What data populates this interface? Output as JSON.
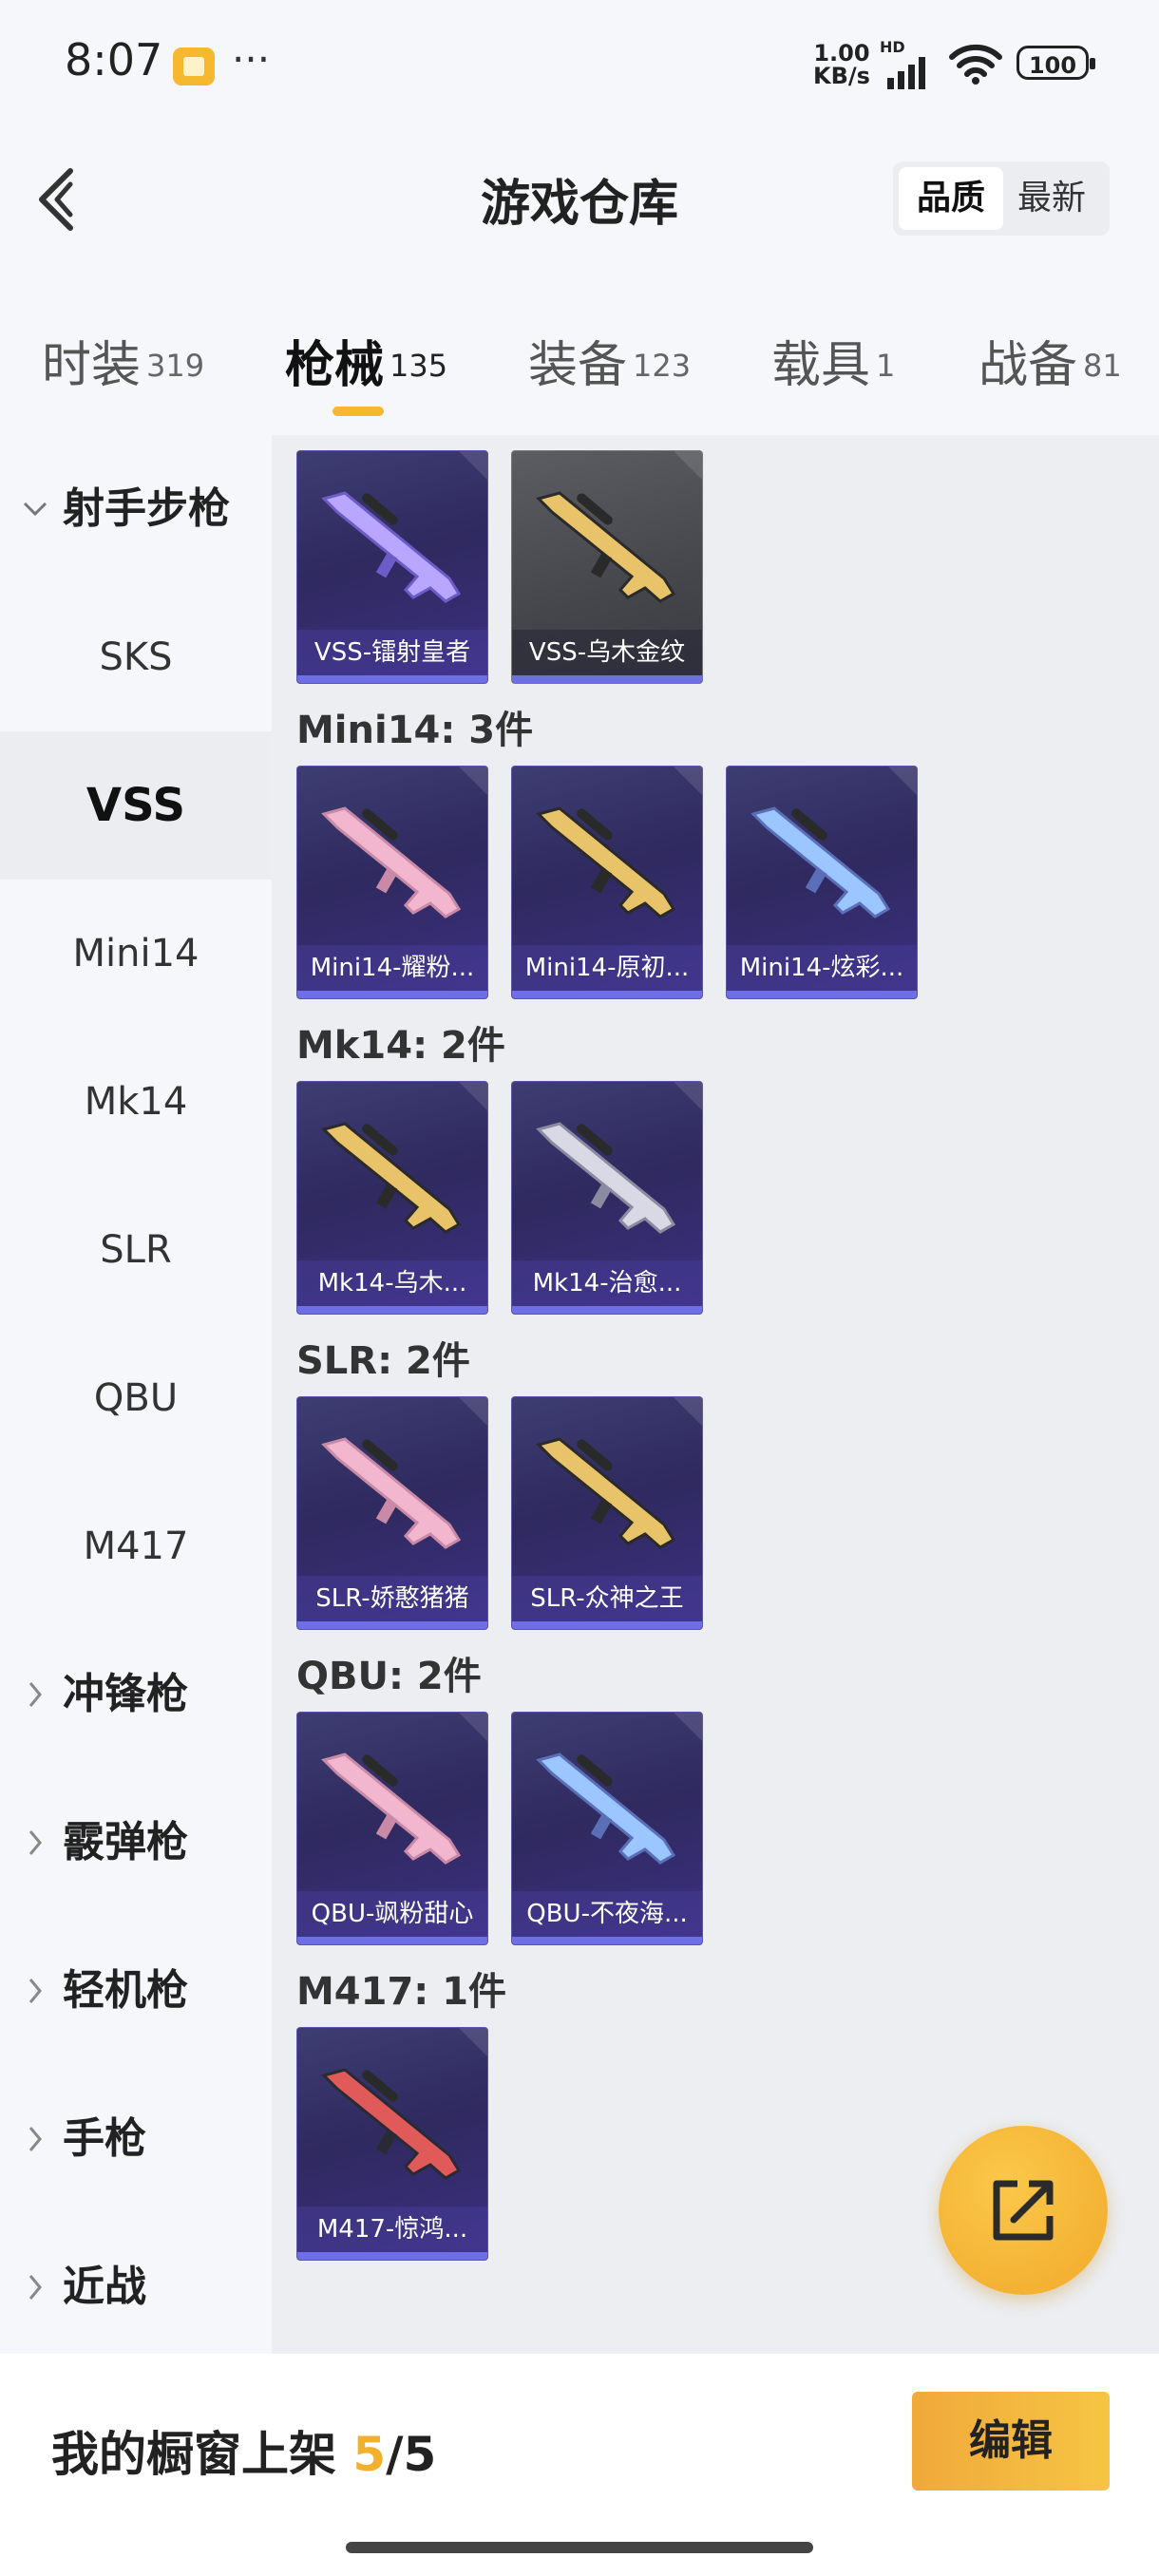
{
  "status_bar": {
    "time": "8:07",
    "dots": "···",
    "net_speed_value": "1.00",
    "net_speed_unit": "KB/s",
    "hd_label": "HD",
    "battery": "100"
  },
  "header": {
    "title": "游戏仓库",
    "sort_options": [
      "品质",
      "最新"
    ],
    "sort_selected": "品质"
  },
  "tabs": [
    {
      "label": "时装",
      "count": "319"
    },
    {
      "label": "枪械",
      "count": "135"
    },
    {
      "label": "装备",
      "count": "123"
    },
    {
      "label": "载具",
      "count": "1"
    },
    {
      "label": "战备",
      "count": "81"
    }
  ],
  "tabs_active": "枪械",
  "sidebar": {
    "expanded_group": "射手步枪",
    "sub_items": [
      "SKS",
      "VSS",
      "Mini14",
      "Mk14",
      "SLR",
      "QBU",
      "M417"
    ],
    "selected_item": "VSS",
    "collapsed_groups": [
      "冲锋枪",
      "霰弹枪",
      "轻机枪",
      "手枪",
      "近战"
    ]
  },
  "sections": [
    {
      "title": "",
      "items": [
        {
          "name": "VSS-镭射皇者",
          "skin": "purple"
        },
        {
          "name": "VSS-乌木金纹",
          "skin": "gold"
        }
      ]
    },
    {
      "title": "Mini14: 3件",
      "items": [
        {
          "name": "Mini14-耀粉...",
          "skin": "pink"
        },
        {
          "name": "Mini14-原初...",
          "skin": "gold"
        },
        {
          "name": "Mini14-炫彩...",
          "skin": "blue"
        }
      ]
    },
    {
      "title": "Mk14: 2件",
      "items": [
        {
          "name": "Mk14-乌木...",
          "skin": "gold"
        },
        {
          "name": "Mk14-治愈...",
          "skin": "silver"
        }
      ]
    },
    {
      "title": "SLR: 2件",
      "items": [
        {
          "name": "SLR-娇憨猪猪",
          "skin": "pink"
        },
        {
          "name": "SLR-众神之王",
          "skin": "gold"
        }
      ]
    },
    {
      "title": "QBU: 2件",
      "items": [
        {
          "name": "QBU-飒粉甜心",
          "skin": "pink"
        },
        {
          "name": "QBU-不夜海...",
          "skin": "blue"
        }
      ]
    },
    {
      "title": "M417: 1件",
      "items": [
        {
          "name": "M417-惊鸿...",
          "skin": "red"
        }
      ]
    }
  ],
  "bottom_bar": {
    "shelf_label": "我的橱窗上架",
    "shelf_current": "5",
    "shelf_total": "/5",
    "edit_label": "编辑"
  },
  "colors": {
    "accent": "#f5b82e",
    "card_bg": "#2f2a5f",
    "card_bar": "#6e6ee6"
  }
}
